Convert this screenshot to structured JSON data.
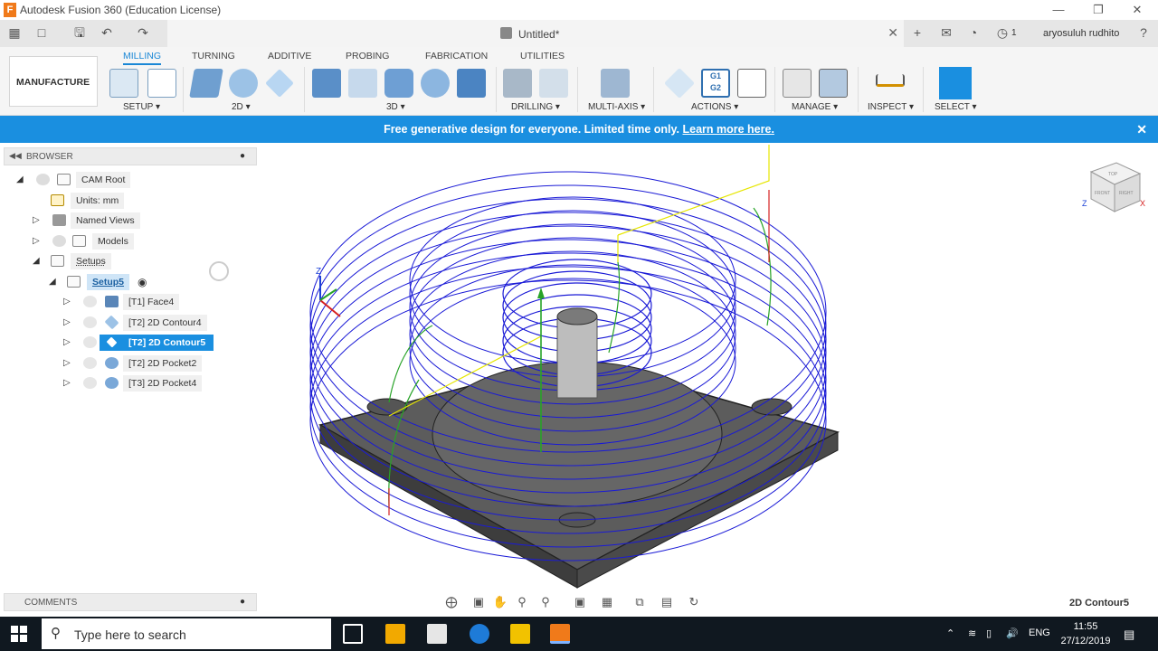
{
  "window": {
    "title": "Autodesk Fusion 360 (Education License)",
    "logo_letter": "F"
  },
  "document": {
    "title": "Untitled*",
    "notification_count": "1",
    "user": "aryosuluh rudhito"
  },
  "ribbon": {
    "workspace": "MANUFACTURE",
    "tabs": [
      "MILLING",
      "TURNING",
      "ADDITIVE",
      "PROBING",
      "FABRICATION",
      "UTILITIES"
    ],
    "active_tab": "MILLING",
    "groups": [
      "SETUP",
      "2D",
      "3D",
      "DRILLING",
      "MULTI-AXIS",
      "ACTIONS",
      "MANAGE",
      "INSPECT",
      "SELECT"
    ],
    "actions_g1g2": "G1\nG2"
  },
  "banner": {
    "text": "Free generative design for everyone. Limited time only. ",
    "link": "Learn more here."
  },
  "browser": {
    "title": "BROWSER",
    "items": [
      {
        "label": "CAM Root"
      },
      {
        "label": "Units: mm"
      },
      {
        "label": "Named Views"
      },
      {
        "label": "Models"
      },
      {
        "label": "Setups"
      },
      {
        "label": "Setup5"
      },
      {
        "label": "[T1] Face4"
      },
      {
        "label": "[T2] 2D Contour4"
      },
      {
        "label": "[T2] 2D Contour5"
      },
      {
        "label": "[T2] 2D Pocket2"
      },
      {
        "label": "[T3] 2D Pocket4"
      }
    ]
  },
  "comments": {
    "title": "COMMENTS"
  },
  "viewcube": {
    "top": "TOP",
    "front": "FRONT",
    "right": "RIGHT",
    "axis_x": "X",
    "axis_z": "Z"
  },
  "triad": {
    "z": "Z"
  },
  "status": {
    "selected_operation": "2D Contour5"
  },
  "taskbar": {
    "search_placeholder": "Type here to search",
    "language": "ENG",
    "time": "11:55",
    "date": "27/12/2019"
  },
  "colors": {
    "accent": "#1a8fe0",
    "toolpath_blue": "#1a1ad6",
    "lead_green": "#27a327",
    "rapid_yellow": "#e6e600"
  }
}
